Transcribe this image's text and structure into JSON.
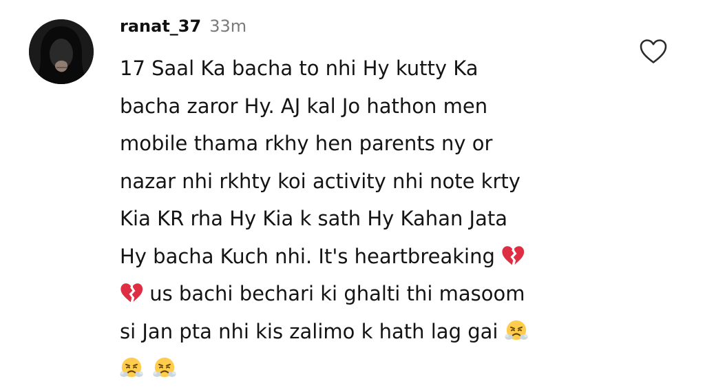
{
  "comment": {
    "username": "ranat_37",
    "timestamp": "33m",
    "avatar_icon": "hooded-figure-avatar",
    "like_icon": "heart-outline-icon",
    "lines": [
      "17 Saal Ka bacha to nhi Hy kutty Ka",
      "bacha zaror Hy. AJ kal Jo hathon men",
      "mobile thama rkhy hen parents ny or",
      "nazar nhi rkhty koi activity nhi note krty",
      "Kia KR rha Hy Kia k sath Hy Kahan Jata",
      "Hy bacha Kuch nhi. It's heartbreaking",
      " us bachi bechari ki ghalti thi masoom",
      "si Jan pta nhi kis zalimo k hath lag gai",
      ""
    ],
    "emojis": [
      "broken-heart-emoji",
      "broken-heart-emoji",
      "steam-from-nose-emoji",
      "steam-from-nose-emoji",
      "steam-from-nose-emoji"
    ]
  }
}
